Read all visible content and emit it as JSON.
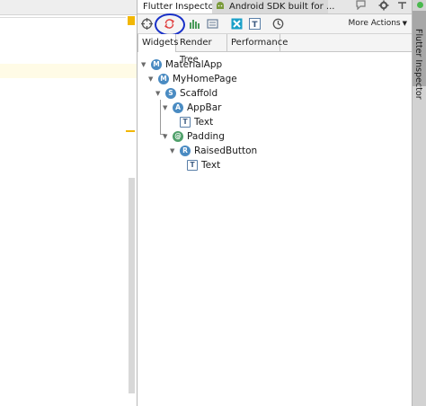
{
  "tool_tabs": [
    {
      "label": "Flutter Inspector"
    },
    {
      "label": "Android SDK built for ..."
    }
  ],
  "header_icons": [
    "chat-icon",
    "gear-icon",
    "hide-panel-icon"
  ],
  "toolbar": {
    "buttons": [
      "select-widget-icon",
      "refresh-icon",
      "performance-overlay-icon",
      "debug-paint-icon",
      "repaint-rainbow-icon",
      "text-baseline-icon",
      "slow-animation-icon"
    ],
    "more_actions_label": "More Actions",
    "annotation_color": "#1830c8"
  },
  "view_tabs": [
    {
      "label": "Widgets"
    },
    {
      "label": "Render Tree"
    },
    {
      "label": "Performance"
    }
  ],
  "tree": [
    {
      "label": "MaterialApp",
      "icon": "M",
      "icon_color": "#4a8bc2"
    },
    {
      "label": "MyHomePage",
      "icon": "M",
      "icon_color": "#4a8bc2"
    },
    {
      "label": "Scaffold",
      "icon": "S",
      "icon_color": "#4a8bc2"
    },
    {
      "label": "AppBar",
      "icon": "A",
      "icon_color": "#4a8bc2"
    },
    {
      "label": "Text",
      "icon": "T",
      "icon_color": "#5a7fa8"
    },
    {
      "label": "Padding",
      "icon": "@",
      "icon_color": "#4fa06a"
    },
    {
      "label": "RaisedButton",
      "icon": "R",
      "icon_color": "#4a8bc2"
    },
    {
      "label": "Text",
      "icon": "T",
      "icon_color": "#5a7fa8"
    }
  ],
  "side_stripe": {
    "label": "Flutter Inspector"
  }
}
